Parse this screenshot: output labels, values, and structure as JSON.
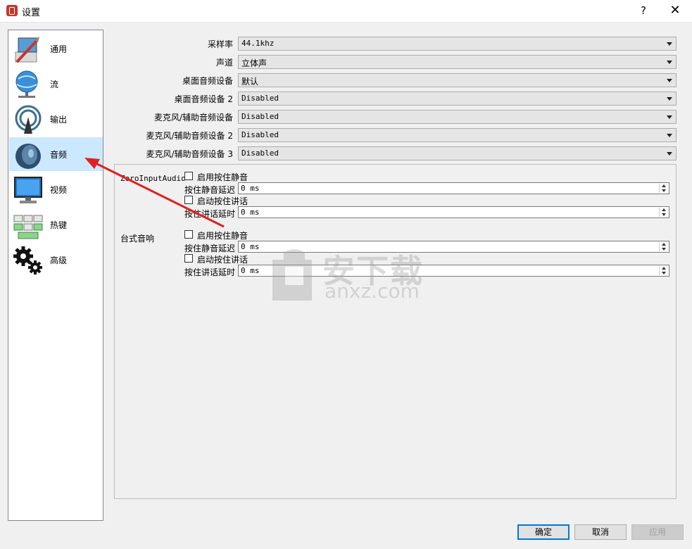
{
  "window": {
    "title": "设置",
    "help": "?",
    "close": "✕"
  },
  "sidebar": {
    "items": [
      {
        "label": "通用",
        "icon": "general-settings-icon",
        "selected": false
      },
      {
        "label": "流",
        "icon": "stream-globe-icon",
        "selected": false
      },
      {
        "label": "输出",
        "icon": "output-broadcast-icon",
        "selected": false
      },
      {
        "label": "音频",
        "icon": "audio-speaker-icon",
        "selected": true
      },
      {
        "label": "视频",
        "icon": "video-monitor-icon",
        "selected": false
      },
      {
        "label": "热键",
        "icon": "hotkeys-keyboard-icon",
        "selected": false
      },
      {
        "label": "高级",
        "icon": "advanced-gears-icon",
        "selected": false
      }
    ]
  },
  "audio": {
    "fields": [
      {
        "label": "采样率",
        "value": "44.1khz",
        "mono": true
      },
      {
        "label": "声道",
        "value": "立体声",
        "mono": false
      },
      {
        "label": "桌面音频设备",
        "value": "默认",
        "mono": false
      },
      {
        "label": "桌面音频设备 2",
        "value": "Disabled",
        "mono": true
      },
      {
        "label": "麦克风/辅助音频设备",
        "value": "Disabled",
        "mono": true
      },
      {
        "label": "麦克风/辅助音频设备 2",
        "value": "Disabled",
        "mono": true
      },
      {
        "label": "麦克风/辅助音频设备 3",
        "value": "Disabled",
        "mono": true
      }
    ],
    "devices": [
      {
        "name": "ZoroInputAudio",
        "push_to_mute": "启用按住静音",
        "push_to_mute_delay_label": "按住静音延迟",
        "push_to_mute_delay": "0 ms",
        "push_to_talk": "启动按住讲话",
        "push_to_talk_delay_label": "按住讲话延时",
        "push_to_talk_delay": "0 ms"
      },
      {
        "name": "台式音响",
        "push_to_mute": "启用按住静音",
        "push_to_mute_delay_label": "按住静音延迟",
        "push_to_mute_delay": "0 ms",
        "push_to_talk": "启动按住讲话",
        "push_to_talk_delay_label": "按住讲话延时",
        "push_to_talk_delay": "0 ms"
      }
    ]
  },
  "buttons": {
    "ok": "确定",
    "cancel": "取消",
    "apply": "应用"
  },
  "watermark": {
    "cn": "安下载",
    "en": "anxz.com"
  },
  "colors": {
    "selected": "#cce8ff",
    "accent": "#0078d7",
    "arrow": "#e02020"
  }
}
